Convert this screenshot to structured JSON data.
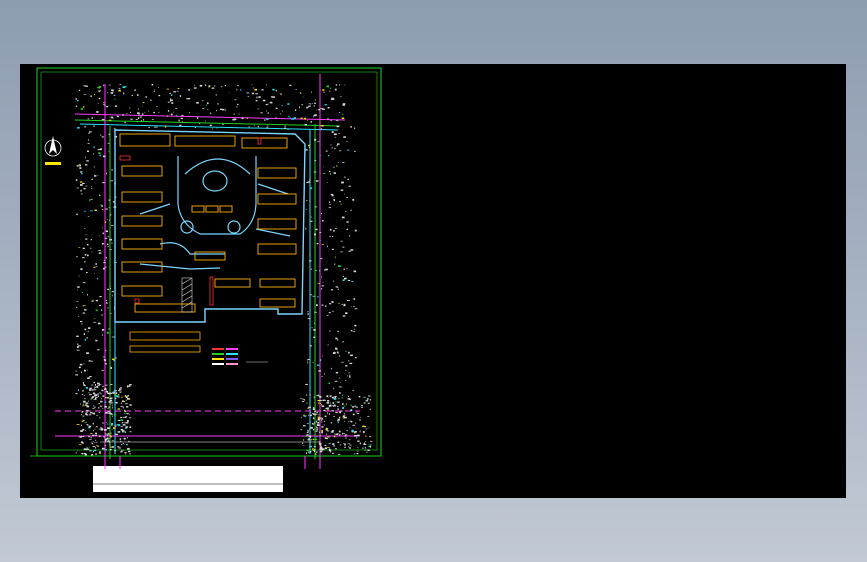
{
  "viewer": {
    "background_color": "#000000",
    "frame_color": "#1fd31f",
    "road_color": "#ff3bff",
    "building_color": "#ffb000",
    "path_color": "#7ad6ff"
  },
  "drawing": {
    "north_arrow_icon": "north-arrow-icon",
    "scale_bar_icon": "scale-bar-icon",
    "legend_icon": "legend-swatches-icon"
  }
}
